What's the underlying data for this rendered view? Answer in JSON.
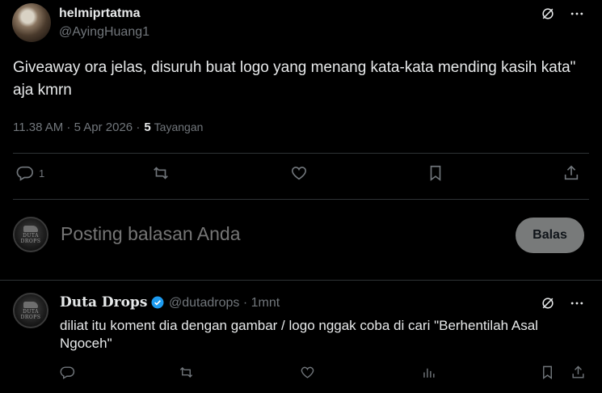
{
  "tweet": {
    "display_name": "helmiprtatma",
    "handle": "@AyingHuang1",
    "text": "Giveaway ora jelas, disuruh buat logo yang menang kata-kata mending kasih kata\" aja kmrn",
    "timestamp": "11.38 AM · 5 Apr 2026 ·",
    "views_count": "5",
    "views_label": "Tayangan",
    "icons": [
      "grok-icon",
      "more-icon"
    ]
  },
  "actions": {
    "replies": "1",
    "retweets": "",
    "likes": "",
    "icons": [
      "reply-icon",
      "retweet-icon",
      "like-icon",
      "bookmark-icon",
      "share-icon"
    ]
  },
  "composer": {
    "placeholder": "Posting balasan Anda",
    "avatar_text": [
      "DUTA",
      "DROPS"
    ],
    "button_label": "Balas"
  },
  "reply": {
    "display_name": "Duta Drops",
    "handle_time": "@dutadrops · 1mnt",
    "text": "diliat itu koment dia dengan gambar / logo nggak coba di cari \"Berhentilah Asal Ngoceh\"",
    "avatar_text": [
      "DUTA",
      "DROPS"
    ],
    "icons": [
      "reply-icon",
      "retweet-icon",
      "like-icon",
      "views-icon",
      "bookmark-icon",
      "share-icon"
    ]
  },
  "colors": {
    "background": "#000000",
    "text_primary": "#e7e9ea",
    "text_secondary": "#71767b",
    "divider": "#2f3336",
    "verified": "#1d9bf0",
    "button_bg": "#787a7a"
  }
}
